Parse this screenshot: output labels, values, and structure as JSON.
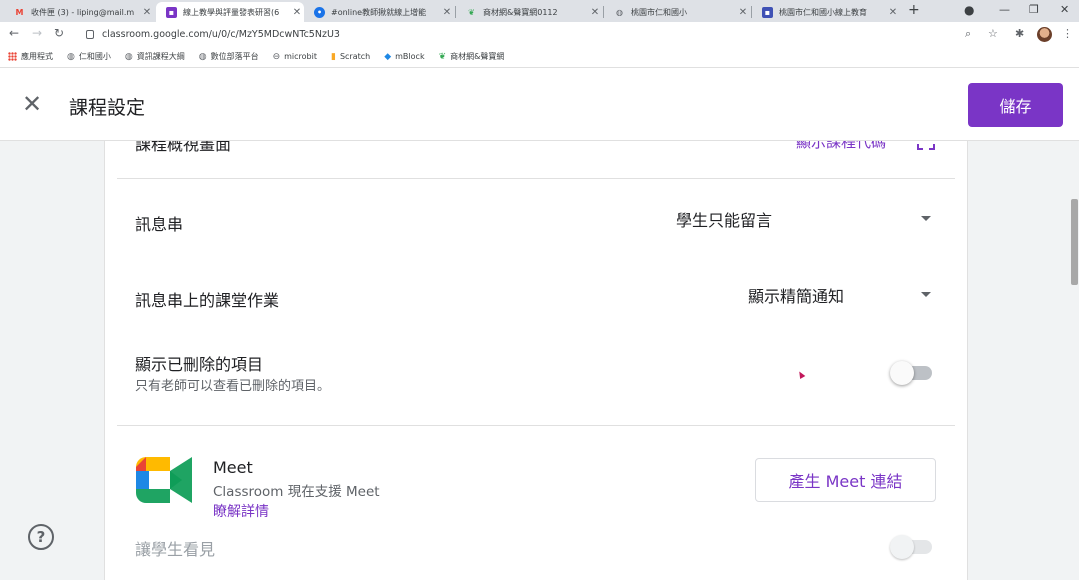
{
  "browser": {
    "tabs": [
      {
        "title": "收件匣 (3) - liping@mail.m",
        "icon": "gmail-icon",
        "active": false
      },
      {
        "title": "線上教學與評量發表研習(6",
        "icon": "classroom-icon",
        "active": true
      },
      {
        "title": "#online教師揪就線上增能",
        "icon": "blue-app-icon",
        "active": false
      },
      {
        "title": "商材網&聲寶網0112",
        "icon": "leaf-icon",
        "active": false
      },
      {
        "title": "桃園市仁和國小",
        "icon": "globe-icon",
        "active": false
      },
      {
        "title": "桃園市仁和國小線上教育",
        "icon": "classroom-icon",
        "active": false
      }
    ],
    "new_tab": "+",
    "url": "classroom.google.com/u/0/c/MzY5MDcwNTc5NzU3",
    "bookmarks": [
      {
        "label": "應用程式",
        "icon": "apps-grid-icon"
      },
      {
        "label": "仁和國小",
        "icon": "globe-icon"
      },
      {
        "label": "資訊課程大綱",
        "icon": "globe-icon"
      },
      {
        "label": "數位部落平台",
        "icon": "globe-icon"
      },
      {
        "label": "microbit",
        "icon": "microbit-icon"
      },
      {
        "label": "Scratch",
        "icon": "scratch-icon"
      },
      {
        "label": "mBlock",
        "icon": "mblock-icon"
      },
      {
        "label": "商材網&聲寶網",
        "icon": "leaf-icon"
      }
    ]
  },
  "header": {
    "title": "課程設定",
    "save_label": "儲存"
  },
  "settings": {
    "preview_label": "課程概視畫面",
    "show_code_link": "顯示課程代碼",
    "stream_label": "訊息串",
    "stream_value": "學生只能留言",
    "classwork_stream_label": "訊息串上的課堂作業",
    "classwork_stream_value": "顯示精簡通知",
    "deleted_items_label": "顯示已刪除的項目",
    "deleted_items_sub": "只有老師可以查看已刪除的項目。",
    "deleted_items_on": false
  },
  "meet": {
    "title": "Meet",
    "description": "Classroom 現在支援 Meet",
    "learn_more": "瞭解詳情",
    "generate_button": "產生 Meet 連結",
    "visible_label": "讓學生看見",
    "visible_on": false
  },
  "help": {
    "label": "?"
  },
  "colors": {
    "accent": "#7a35c6",
    "page_bg": "#f1f3f4"
  }
}
